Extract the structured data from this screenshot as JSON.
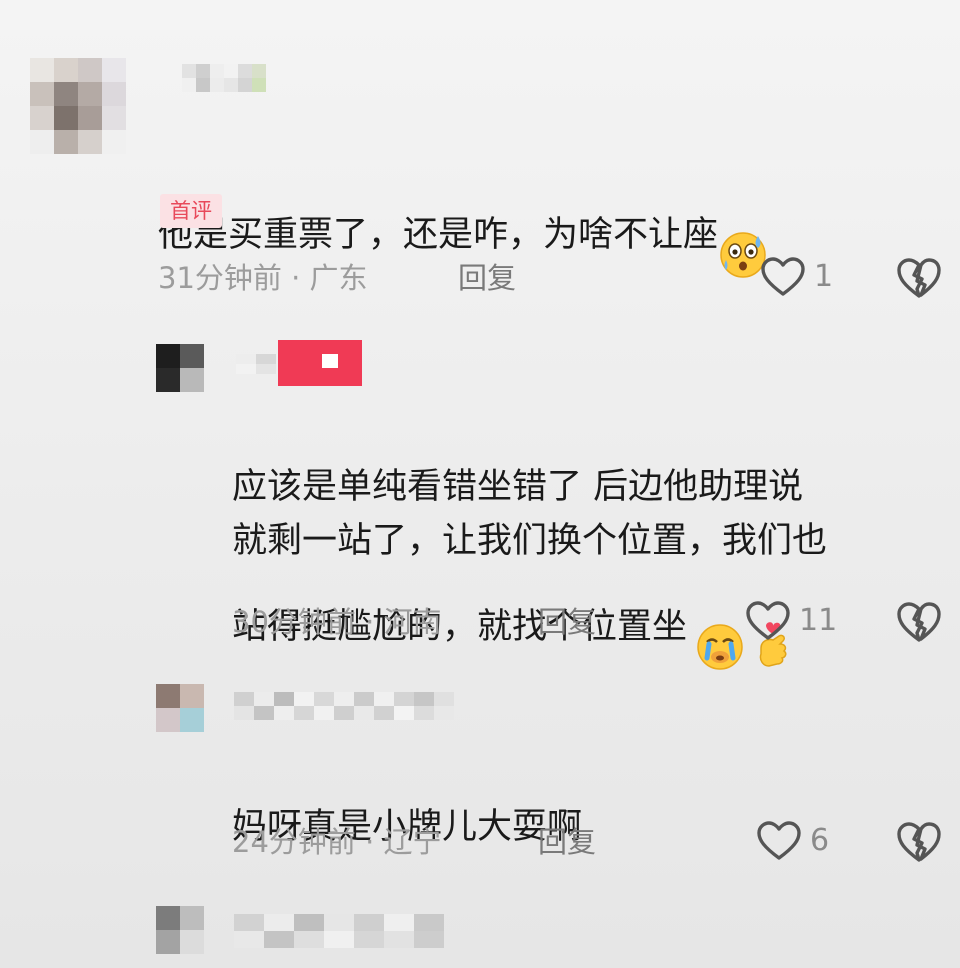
{
  "comments": [
    {
      "text": "他是买重票了，还是咋，为啥不让座",
      "emoji": "astonished-sweat-face",
      "badge": "首评",
      "time_location": "31分钟前 · 广东",
      "reply_label": "回复",
      "likes": "1"
    },
    {
      "text": "应该是单纯看错坐错了 后边他助理说\n就剩一站了，让我们换个位置，我们也\n站得挺尴尬的，就找个位置坐",
      "emoji": [
        "crying-face",
        "finger-heart"
      ],
      "time_location": "30分钟前 · 河南",
      "reply_label": "回复",
      "likes": "11"
    },
    {
      "text": "妈呀真是小牌儿大耍啊",
      "time_location": "24分钟前 · 辽宁",
      "reply_label": "回复",
      "likes": "6"
    }
  ],
  "icons": {
    "like": "heart-outline-icon",
    "dislike": "broken-heart-icon"
  },
  "colors": {
    "badge_bg": "#fbe1e4",
    "badge_text": "#e8495a",
    "name_tag": "#f03a55",
    "meta_text": "#9c9c9c"
  }
}
